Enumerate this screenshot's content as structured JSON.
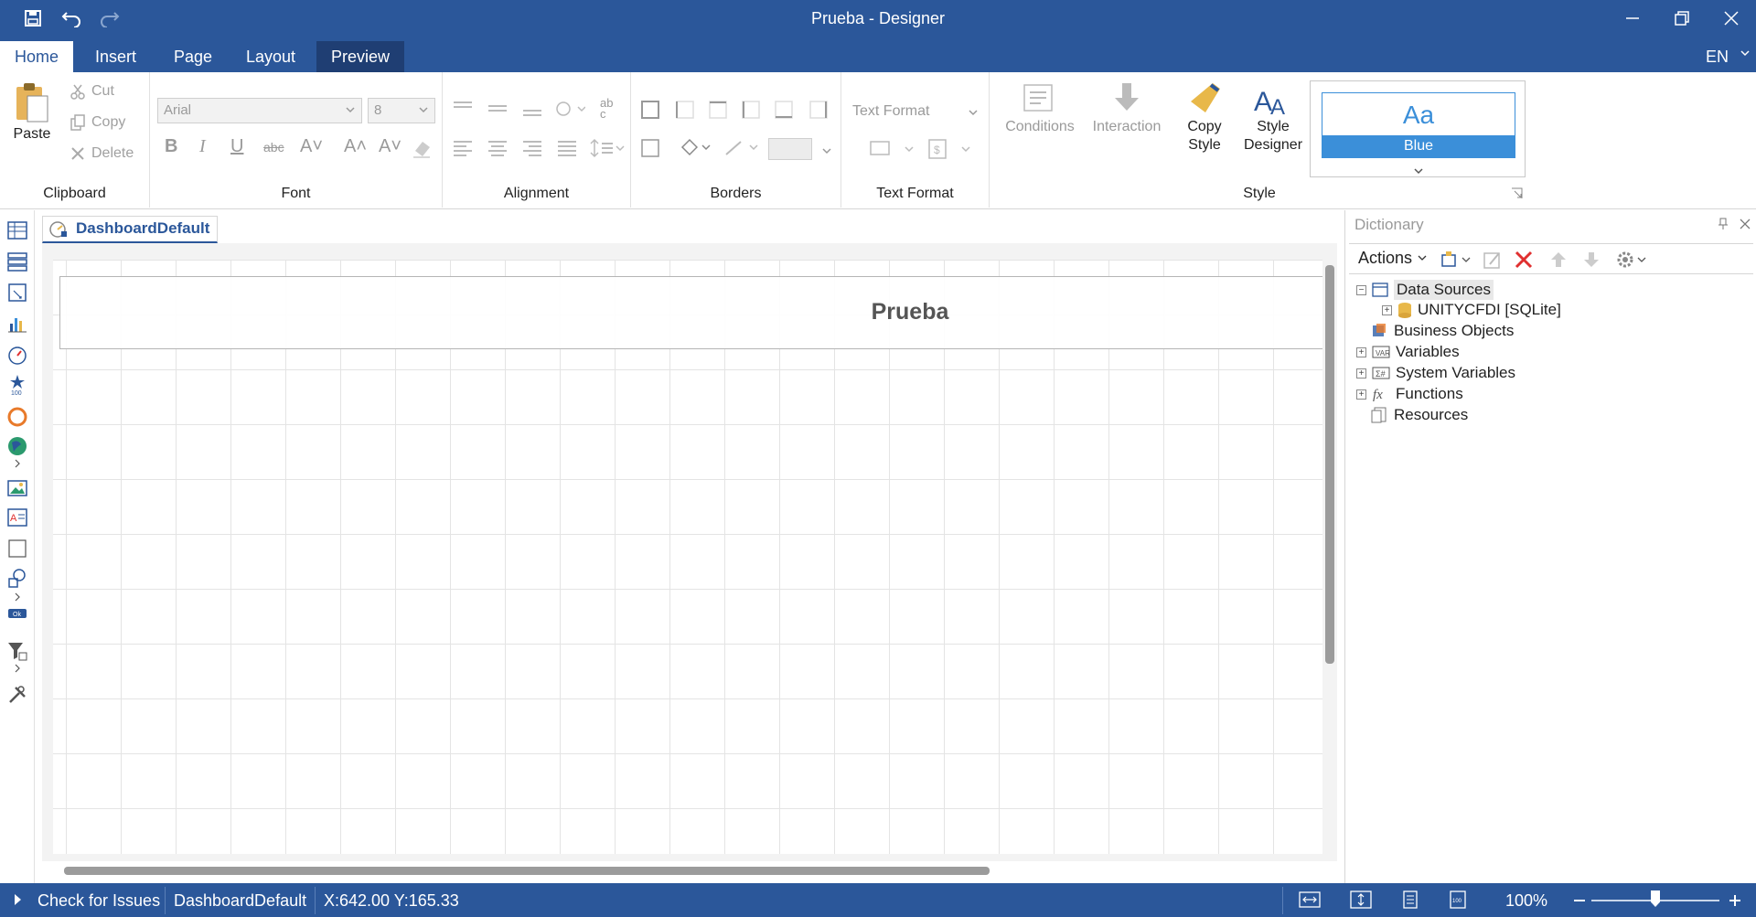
{
  "window": {
    "title": "Prueba - Designer"
  },
  "tabs": [
    {
      "label": "Home"
    },
    {
      "label": "Insert"
    },
    {
      "label": "Page"
    },
    {
      "label": "Layout"
    },
    {
      "label": "Preview"
    }
  ],
  "language": "EN",
  "ribbon": {
    "clipboard": {
      "paste": "Paste",
      "cut": "Cut",
      "copy": "Copy",
      "delete": "Delete",
      "label": "Clipboard"
    },
    "font": {
      "family": "Arial",
      "size": "8",
      "label": "Font"
    },
    "alignment": {
      "label": "Alignment"
    },
    "borders": {
      "label": "Borders"
    },
    "text_format": {
      "combo": "Text Format",
      "label": "Text Format"
    },
    "style": {
      "conditions": "Conditions",
      "interaction": "Interaction",
      "copy_style_1": "Copy",
      "copy_style_2": "Style",
      "style_designer_1": "Style",
      "style_designer_2": "Designer",
      "preview_glyph": "Aa",
      "preview_name": "Blue",
      "label": "Style"
    }
  },
  "document": {
    "tab": "DashboardDefault",
    "title_text": "Prueba"
  },
  "dictionary": {
    "header": "Dictionary",
    "actions": "Actions",
    "tree": [
      {
        "label": "Data Sources",
        "expander": "−"
      },
      {
        "label": "UNITYCFDI [SQLite]",
        "expander": "+"
      },
      {
        "label": "Business Objects",
        "expander": ""
      },
      {
        "label": "Variables",
        "expander": "+"
      },
      {
        "label": "System Variables",
        "expander": "+"
      },
      {
        "label": "Functions",
        "expander": "+"
      },
      {
        "label": "Resources",
        "expander": ""
      }
    ]
  },
  "status": {
    "check_issues": "Check for Issues",
    "page_name": "DashboardDefault",
    "coords": "X:642.00 Y:165.33",
    "zoom": "100%",
    "zoom_level": 0.5
  },
  "colors": {
    "accent": "#2b579a",
    "style_blue": "#3b8fd9",
    "delete_red": "#e02f2f"
  }
}
